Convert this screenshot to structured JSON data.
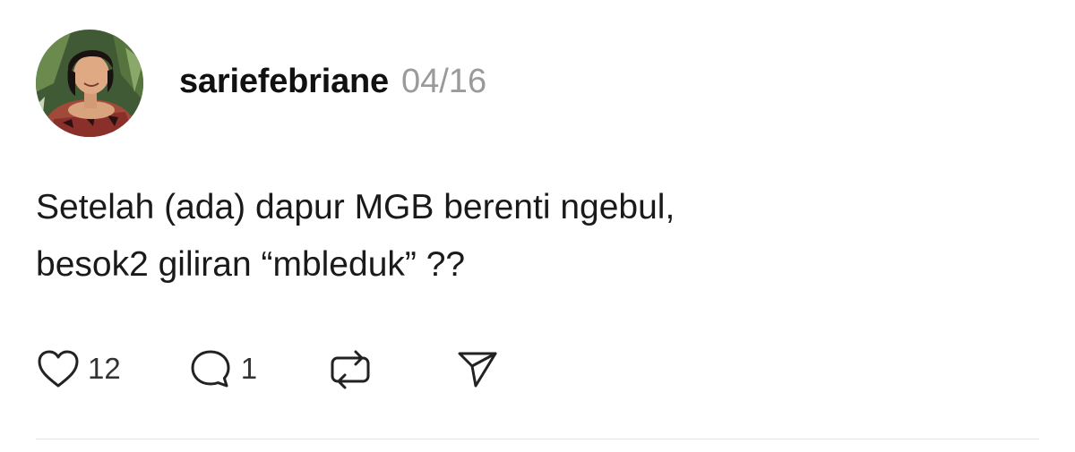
{
  "post": {
    "username": "sariefebriane",
    "date": "04/16",
    "text_lines": [
      "Setelah (ada) dapur MGB berenti ngebul,",
      "besok2 giliran “mbleduk” ??"
    ],
    "avatar_icon": "profile-photo"
  },
  "actions": {
    "like": {
      "icon": "heart-icon",
      "count": "12"
    },
    "reply": {
      "icon": "speech-bubble-icon",
      "count": "1"
    },
    "repost": {
      "icon": "repost-arrows-icon"
    },
    "share": {
      "icon": "paper-plane-icon"
    }
  },
  "colors": {
    "username": "#111111",
    "date": "#9a9a9a",
    "text": "#1a1a1a",
    "icon_stroke": "#222222",
    "divider": "#e4e4e4"
  }
}
